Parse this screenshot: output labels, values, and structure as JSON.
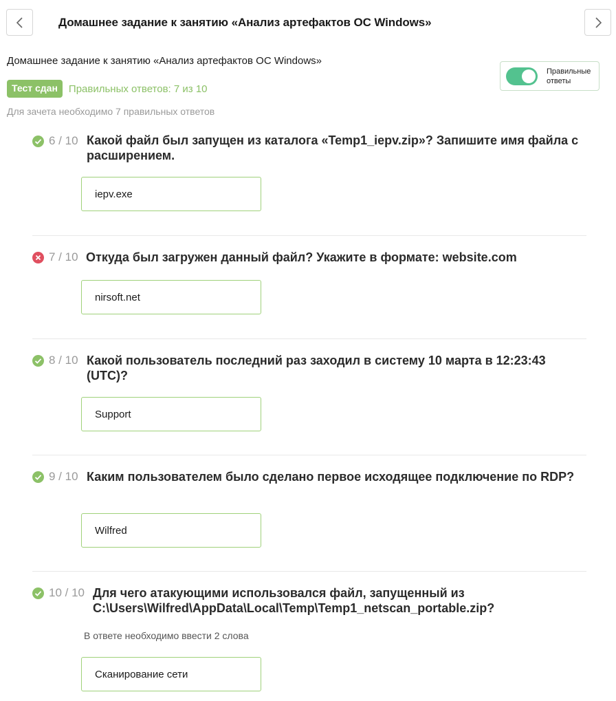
{
  "header": {
    "title": "Домашнее задание к занятию «Анализ артефактов ОС Windows»"
  },
  "summary": {
    "subtitle": "Домашнее задание к занятию «Анализ артефактов ОС Windows»",
    "badge": "Тест сдан",
    "score": "Правильных ответов: 7 из 10",
    "requirement": "Для зачета необходимо 7 правильных ответов",
    "toggle_label": "Правильные ответы",
    "toggle_on": true
  },
  "colors": {
    "success": "#8cc167",
    "error": "#e04f5f",
    "toggle": "#53c28f"
  },
  "questions": [
    {
      "number": "6 / 10",
      "status": "correct",
      "icon": "check-circle-icon",
      "text": "Какой файл был запущен из каталога «Temp1_iepv.zip»? Запишите имя файла с расширением.",
      "answer": "iepv.exe"
    },
    {
      "number": "7 / 10",
      "status": "incorrect",
      "icon": "cross-circle-icon",
      "text": "Откуда был загружен данный файл? Укажите в формате: website.com",
      "answer": "nirsoft.net"
    },
    {
      "number": "8 / 10",
      "status": "correct",
      "icon": "check-circle-icon",
      "text": "Какой пользователь последний раз заходил в систему 10 марта в 12:23:43 (UTC)?",
      "answer": "Support"
    },
    {
      "number": "9 / 10",
      "status": "correct",
      "icon": "check-circle-icon",
      "text": "Каким пользователем было сделано первое исходящее подключение по RDP?",
      "answer": "Wilfred"
    },
    {
      "number": "10 / 10",
      "status": "correct",
      "icon": "check-circle-icon",
      "text": "Для чего атакующими использовался файл, запущенный из C:\\Users\\Wilfred\\AppData\\Local\\Temp\\Temp1_netscan_portable.zip?",
      "hint": "В ответе необходимо ввести 2 слова",
      "answer": "Сканирование сети"
    }
  ]
}
